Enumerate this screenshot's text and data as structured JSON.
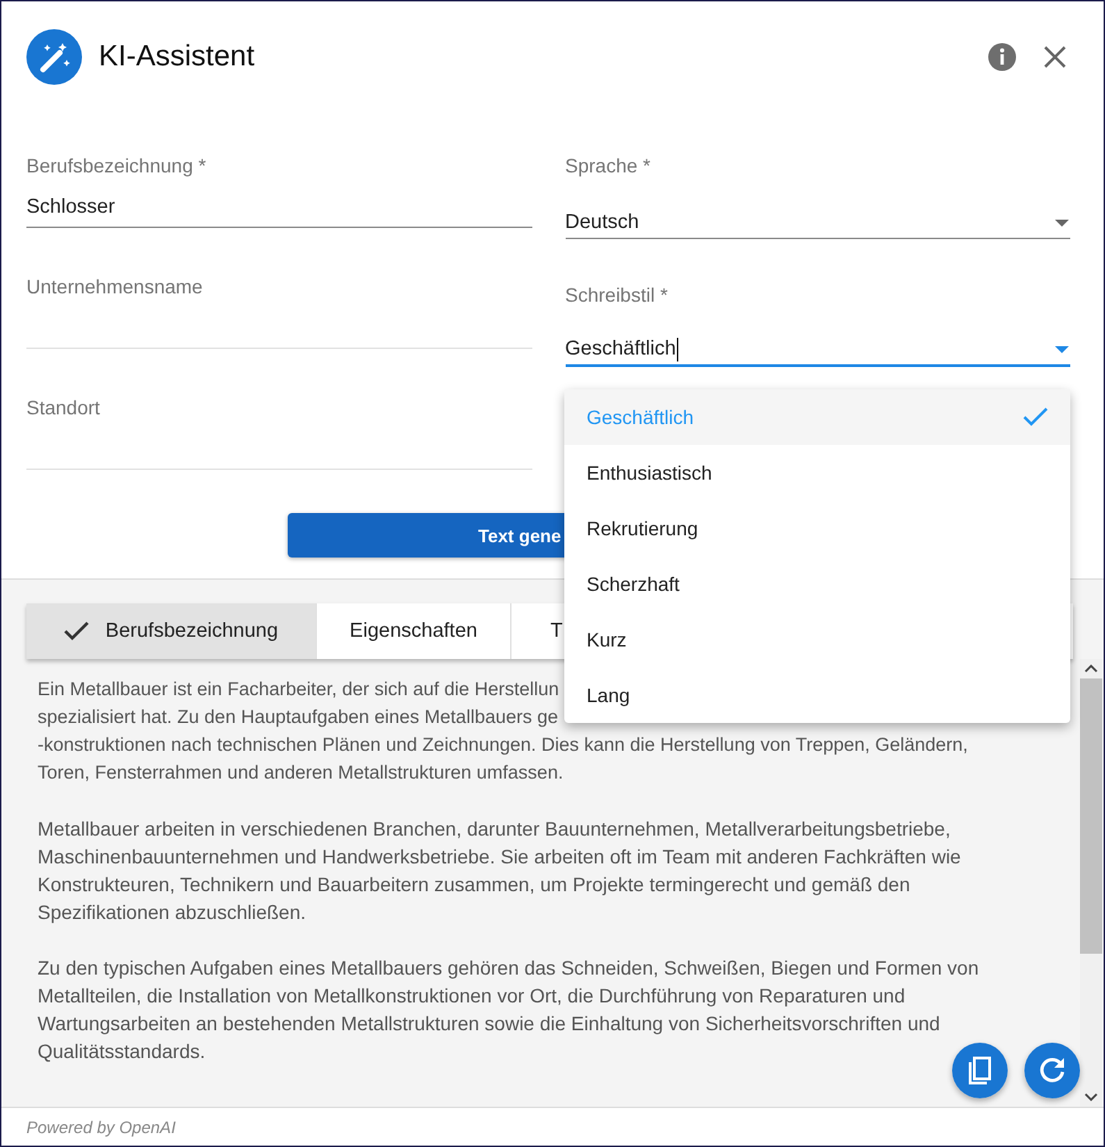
{
  "header": {
    "title": "KI-Assistent"
  },
  "form": {
    "left": [
      {
        "label": "Berufsbezeichnung *",
        "value": "Schlosser"
      },
      {
        "label": "Unternehmensname"
      },
      {
        "label": "Standort"
      }
    ],
    "right": [
      {
        "label": "Sprache *",
        "value": "Deutsch",
        "focused": false
      },
      {
        "label": "Schreibstil *",
        "value": "Geschäftlich",
        "focused": true
      }
    ]
  },
  "generate_button": "Text gene",
  "dropdown": {
    "options": [
      {
        "label": "Geschäftlich",
        "selected": true
      },
      {
        "label": "Enthusiastisch",
        "selected": false
      },
      {
        "label": "Rekrutierung",
        "selected": false
      },
      {
        "label": "Scherzhaft",
        "selected": false
      },
      {
        "label": "Kurz",
        "selected": false
      },
      {
        "label": "Lang",
        "selected": false
      }
    ]
  },
  "tabs": [
    {
      "label": "Berufsbezeichnung",
      "selected": true
    },
    {
      "label": "Eigenschaften",
      "selected": false
    },
    {
      "label": "T",
      "selected": false
    }
  ],
  "result": {
    "paragraphs": [
      {
        "kind": "lines",
        "lines": [
          "Ein Metallbauer ist ein Facharbeiter, der sich auf die Herstellun",
          "spezialisiert hat. Zu den Hauptaufgaben eines Metallbauers ge",
          "-konstruktionen nach technischen Plänen und Zeichnungen. Dies kann die Herstellung von Treppen, Geländern,",
          "Toren, Fensterrahmen und anderen Metallstrukturen umfassen."
        ]
      },
      {
        "kind": "text",
        "text": "Metallbauer arbeiten in verschiedenen Branchen, darunter Bauunternehmen, Metallverarbeitungsbetriebe, Maschinenbauunternehmen und Handwerksbetriebe. Sie arbeiten oft im Team mit anderen Fachkräften wie Konstrukteuren, Technikern und Bauarbeitern zusammen, um Projekte termingerecht und gemäß den Spezifikationen abzuschließen."
      },
      {
        "kind": "text",
        "text": "Zu den typischen Aufgaben eines Metallbauers gehören das Schneiden, Schweißen, Biegen und Formen von Metallteilen, die Installation von Metallkonstruktionen vor Ort, die Durchführung von Reparaturen und Wartungsarbeiten an bestehenden Metallstrukturen sowie die Einhaltung von Sicherheitsvorschriften und Qualitätsstandards."
      }
    ]
  },
  "footer": {
    "text": "Powered by OpenAI"
  }
}
